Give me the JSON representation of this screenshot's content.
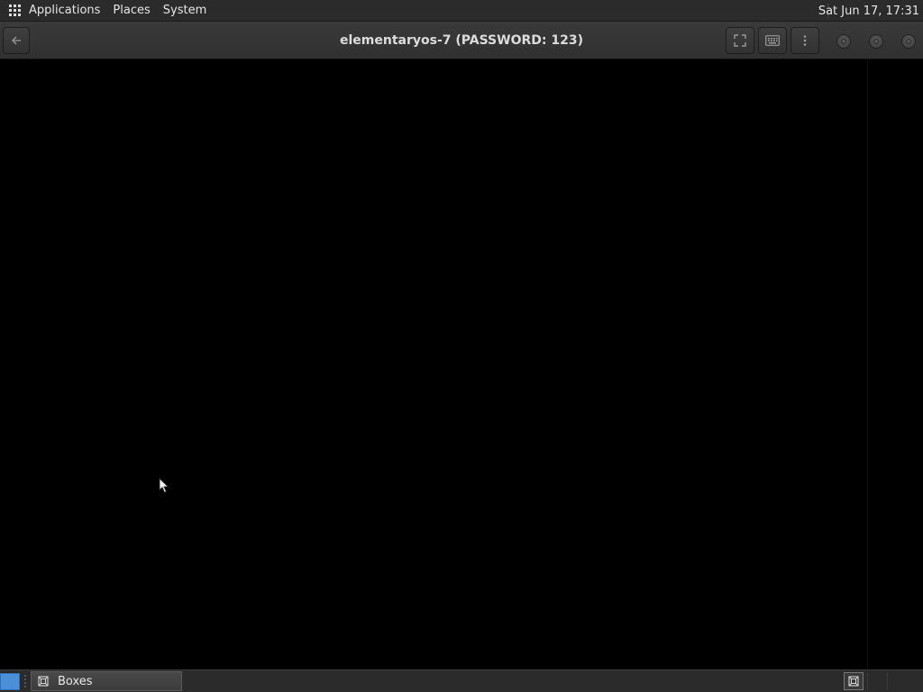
{
  "top_panel": {
    "menus": [
      "Applications",
      "Places",
      "System"
    ],
    "clock": "Sat Jun 17, 17:31"
  },
  "window": {
    "title": "elementaryos-7 (PASSWORD: 123)",
    "buttons": {
      "back": "back-arrow-icon",
      "fullscreen": "fullscreen-icon",
      "keyboard": "keyboard-icon",
      "menu": "kebab-menu-icon"
    }
  },
  "vm_display": {
    "background": "#000000"
  },
  "taskbar": {
    "tasks": [
      {
        "label": "Boxes",
        "icon": "boxes-icon"
      }
    ]
  },
  "colors": {
    "panel": "#2b2b2b",
    "headerbar": "#353535",
    "show_desktop": "#4a8fd8"
  }
}
